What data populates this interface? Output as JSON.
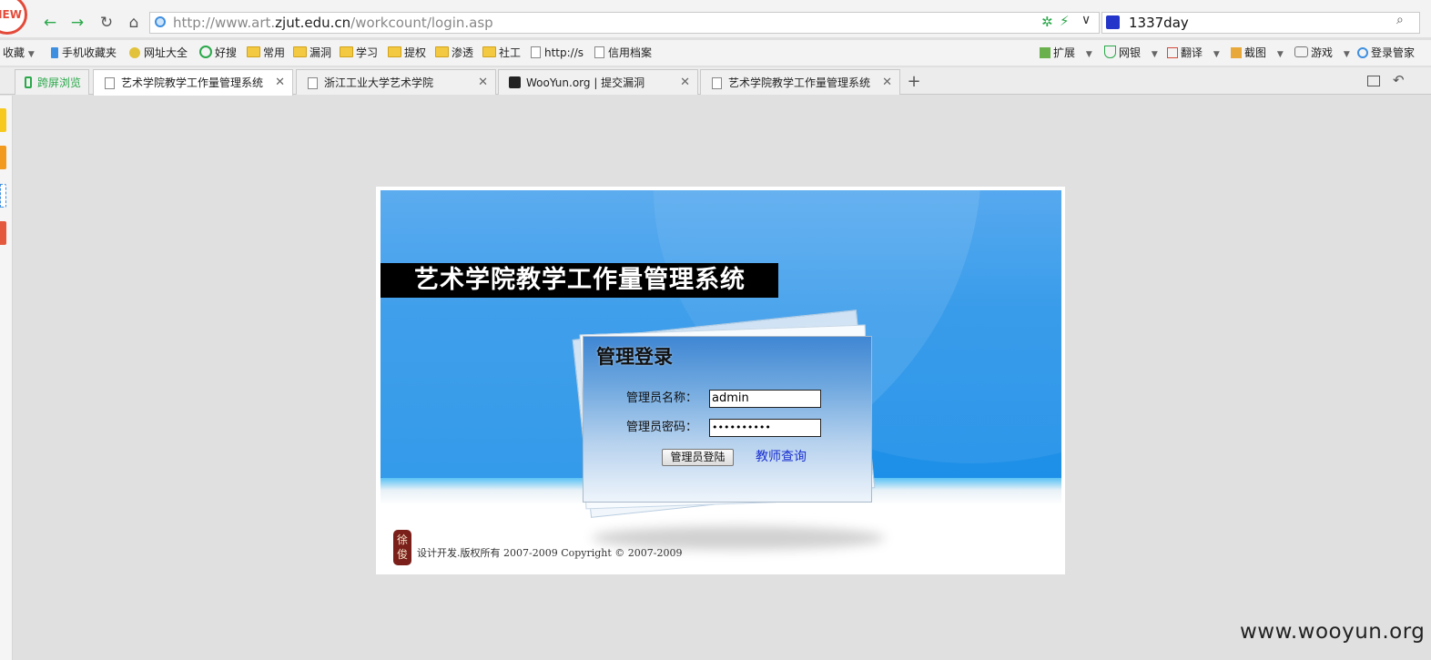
{
  "browser": {
    "new_badge": "NEW",
    "url": {
      "prefix": "http://www.art.",
      "domain": "zjut.edu.cn",
      "path": "/workcount/login.asp"
    },
    "search_value": "1337day",
    "bookmarks": [
      {
        "label": "收藏"
      },
      {
        "label": "手机收藏夹"
      },
      {
        "label": "网址大全"
      },
      {
        "label": "好搜"
      },
      {
        "label": "常用"
      },
      {
        "label": "漏洞"
      },
      {
        "label": "学习"
      },
      {
        "label": "提权"
      },
      {
        "label": "渗透"
      },
      {
        "label": "社工"
      },
      {
        "label": "http://s"
      },
      {
        "label": "信用档案"
      }
    ],
    "tools": [
      {
        "label": "扩展"
      },
      {
        "label": "网银"
      },
      {
        "label": "翻译"
      },
      {
        "label": "截图"
      },
      {
        "label": "游戏"
      },
      {
        "label": "登录管家"
      }
    ],
    "tabs": [
      {
        "label": "跨屏浏览"
      },
      {
        "label": "艺术学院教学工作量管理系统"
      },
      {
        "label": "浙江工业大学艺术学院"
      },
      {
        "label": "WooYun.org | 提交漏洞"
      },
      {
        "label": "艺术学院教学工作量管理系统"
      }
    ],
    "close_glyph": "✕",
    "new_tab_glyph": "+",
    "accent": "#2aa84a"
  },
  "page": {
    "system_title": "艺术学院教学工作量管理系统",
    "login": {
      "title": "管理登录",
      "username_label": "管理员名称：",
      "username_value": "admin",
      "password_label": "管理员密码：",
      "password_value": "••••••••••",
      "login_button": "管理员登陆",
      "teacher_link": "教师查询"
    },
    "footer": {
      "seal_text": "徐俊",
      "copyright": "设计开发.版权所有 2007-2009 Copyright © 2007-2009"
    },
    "banner_color": "#2b95e9"
  },
  "watermark": "www.wooyun.org"
}
